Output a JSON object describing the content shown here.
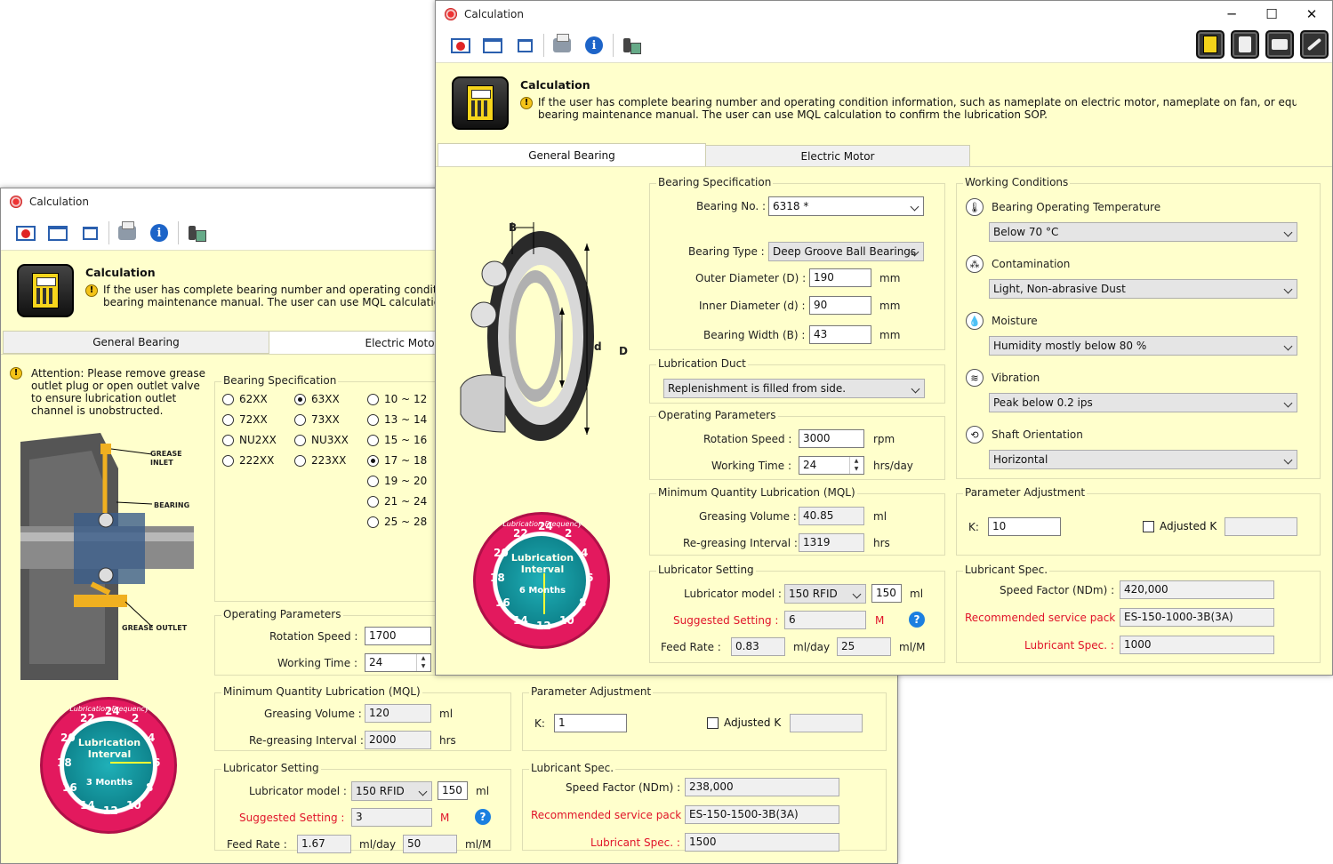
{
  "back_window": {
    "title": "Calculation",
    "header_title": "Calculation",
    "header_text_1": "If the user has complete bearing number and operating condition information, such as nameplate on electric motor, nameplate on fan, or equipment with",
    "header_text_2": "bearing maintenance manual. The user can use MQL calculation to confirm the lubrication SOP.",
    "tabs": [
      "General Bearing",
      "Electric Motor"
    ],
    "attention": [
      "Attention: Please remove grease",
      "outlet plug or open outlet valve",
      "to ensure lubrication outlet",
      "channel is unobstructed."
    ],
    "diagram_labels": {
      "inlet": "GREASE\nINLET",
      "bearing": "BEARING",
      "outlet": "GREASE OUTLET"
    },
    "bearing_spec": {
      "title": "Bearing Specification",
      "series": [
        "62XX",
        "63XX",
        "72XX",
        "73XX",
        "NU2XX",
        "NU3XX",
        "222XX",
        "223XX"
      ],
      "selected_series": "63XX",
      "ranges": [
        "10 ~ 12",
        "13 ~ 14",
        "15 ~ 16",
        "17 ~ 18",
        "19 ~ 20",
        "21 ~ 24",
        "25 ~ 28"
      ],
      "selected_range": "17 ~ 18"
    },
    "operating": {
      "title": "Operating Parameters",
      "speed_label": "Rotation Speed :",
      "speed": "1700",
      "time_label": "Working Time :",
      "time": "24"
    },
    "mql": {
      "title": "Minimum Quantity Lubrication (MQL)",
      "volume_label": "Greasing Volume :",
      "volume": "120",
      "volume_unit": "ml",
      "interval_label": "Re-greasing Interval :",
      "interval": "2000",
      "interval_unit": "hrs"
    },
    "lubricator": {
      "title": "Lubricator Setting",
      "model_label": "Lubricator model :",
      "model": "150 RFID",
      "capacity": "150",
      "capacity_unit": "ml",
      "suggest_label": "Suggested Setting :",
      "suggest": "3",
      "suggest_unit": "M",
      "feed_label": "Feed Rate :",
      "feed": "1.67",
      "feed_unit": "ml/day",
      "feed2": "50",
      "feed2_unit": "ml/M"
    },
    "param": {
      "title": "Parameter Adjustment",
      "k_label": "K:",
      "k": "1",
      "adjusted_label": "Adjusted K"
    },
    "lubricant": {
      "title": "Lubricant Spec.",
      "speed_label": "Speed Factor (NDm) :",
      "speed": "238,000",
      "pack_label": "Recommended service pack :",
      "pack": "ES-150-1500-3B(3A)",
      "spec_label": "Lubricant Spec. :",
      "spec": "1500"
    },
    "dial": {
      "caption": "Lubrication Frequency",
      "title": "Lubrication\nInterval",
      "months": "3 Months",
      "numbers": [
        "22",
        "24",
        "2",
        "20",
        "4",
        "18",
        "6",
        "16",
        "8",
        "14",
        "12",
        "10"
      ]
    }
  },
  "front_window": {
    "title": "Calculation",
    "header_title": "Calculation",
    "header_text_1": "If the user has complete bearing number and operating condition information, such as nameplate on electric motor, nameplate on fan, or equipment with",
    "header_text_2": "bearing maintenance manual. The user can use MQL calculation to confirm the lubrication SOP.",
    "tabs": [
      "General Bearing",
      "Electric Motor"
    ],
    "diagram_labels": {
      "B": "B",
      "d": "d",
      "D": "D"
    },
    "bearing_spec": {
      "title": "Bearing Specification",
      "no_label": "Bearing No. :",
      "no": "6318 *",
      "type_label": "Bearing Type :",
      "type": "Deep Groove Ball Bearings",
      "od_label": "Outer Diameter (D) :",
      "od": "190",
      "id_label": "Inner Diameter (d) :",
      "id": "90",
      "width_label": "Bearing Width (B) :",
      "width": "43",
      "unit": "mm"
    },
    "duct": {
      "title": "Lubrication Duct",
      "value": "Replenishment is filled from side."
    },
    "operating": {
      "title": "Operating Parameters",
      "speed_label": "Rotation Speed :",
      "speed": "3000",
      "speed_unit": "rpm",
      "time_label": "Working Time :",
      "time": "24",
      "time_unit": "hrs/day"
    },
    "mql": {
      "title": "Minimum Quantity Lubrication (MQL)",
      "volume_label": "Greasing Volume :",
      "volume": "40.85",
      "volume_unit": "ml",
      "interval_label": "Re-greasing Interval :",
      "interval": "1319",
      "interval_unit": "hrs"
    },
    "lubricator": {
      "title": "Lubricator Setting",
      "model_label": "Lubricator model :",
      "model": "150 RFID",
      "capacity": "150",
      "capacity_unit": "ml",
      "suggest_label": "Suggested Setting :",
      "suggest": "6",
      "suggest_unit": "M",
      "feed_label": "Feed Rate :",
      "feed": "0.83",
      "feed_unit": "ml/day",
      "feed2": "25",
      "feed2_unit": "ml/M"
    },
    "working": {
      "title": "Working Conditions",
      "temp_label": "Bearing Operating Temperature",
      "temp": "Below 70 °C",
      "cont_label": "Contamination",
      "cont": "Light, Non-abrasive Dust",
      "moist_label": "Moisture",
      "moist": "Humidity mostly below 80 %",
      "vib_label": "Vibration",
      "vib": "Peak below 0.2 ips",
      "shaft_label": "Shaft Orientation",
      "shaft": "Horizontal"
    },
    "param": {
      "title": "Parameter Adjustment",
      "k_label": "K:",
      "k": "10",
      "adjusted_label": "Adjusted K"
    },
    "lubricant": {
      "title": "Lubricant Spec.",
      "speed_label": "Speed Factor (NDm) :",
      "speed": "420,000",
      "pack_label": "Recommended service pack :",
      "pack": "ES-150-1000-3B(3A)",
      "spec_label": "Lubricant Spec. :",
      "spec": "1000"
    },
    "dial": {
      "caption": "Lubrication Frequency",
      "title": "Lubrication\nInterval",
      "months": "6 Months",
      "numbers": [
        "22",
        "24",
        "2",
        "20",
        "4",
        "18",
        "6",
        "16",
        "8",
        "14",
        "12",
        "10"
      ]
    }
  },
  "window_controls": {
    "minimize": "─",
    "maximize": "☐",
    "close": "✕"
  },
  "help_glyph": "?",
  "warn_glyph": "!"
}
